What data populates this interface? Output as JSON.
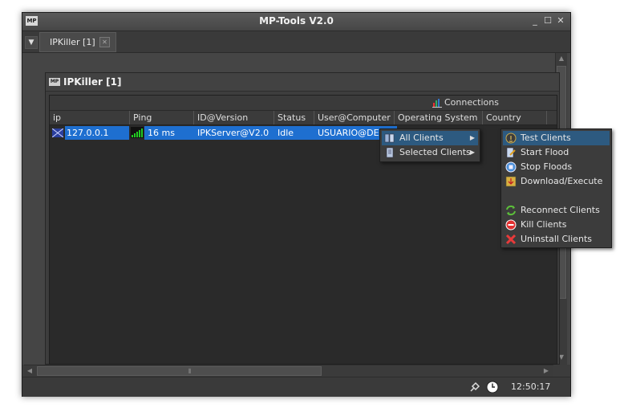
{
  "window": {
    "title": "MP-Tools V2.0",
    "logo_text": "MP",
    "minimize": "_",
    "maximize": "☐",
    "close": "✕"
  },
  "tabs": [
    {
      "label": "IPKiller [1]",
      "close": "✕"
    }
  ],
  "inner_window": {
    "title": "IPKiller [1]",
    "logo_text": "MP"
  },
  "toolbar": {
    "connections_label": "Connections"
  },
  "grid": {
    "columns": [
      "ip",
      "Ping",
      "ID@Version",
      "Status",
      "User@Computer",
      "Operating System",
      "Country"
    ],
    "rows": [
      {
        "ip": "127.0.0.1",
        "ping": "16 ms",
        "id_version": "IPKServer@V2.0",
        "status": "Idle",
        "user_computer": "USUARIO@DES..."
      }
    ]
  },
  "context_menu": {
    "items": [
      {
        "label": "All Clients",
        "has_submenu": true,
        "highlighted": true,
        "icon": "book-icon"
      },
      {
        "label": "Selected Clients",
        "has_submenu": true,
        "highlighted": false,
        "icon": "document-icon"
      }
    ]
  },
  "submenu": {
    "items": [
      {
        "label": "Test Clients",
        "icon": "signal-icon",
        "highlighted": true
      },
      {
        "label": "Start Flood",
        "icon": "edit-icon"
      },
      {
        "label": "Stop Floods",
        "icon": "stop-icon"
      },
      {
        "label": "Download/Execute",
        "icon": "download-icon"
      },
      {
        "label": "Reconnect Clients",
        "icon": "refresh-icon"
      },
      {
        "label": "Kill Clients",
        "icon": "no-entry-icon"
      },
      {
        "label": "Uninstall Clients",
        "icon": "x-mark-icon"
      }
    ]
  },
  "statusbar": {
    "time": "12:50:17"
  },
  "colors": {
    "selection": "#1e6fd0",
    "menu_highlight": "#2d5a80",
    "background": "#3c3c3c"
  }
}
